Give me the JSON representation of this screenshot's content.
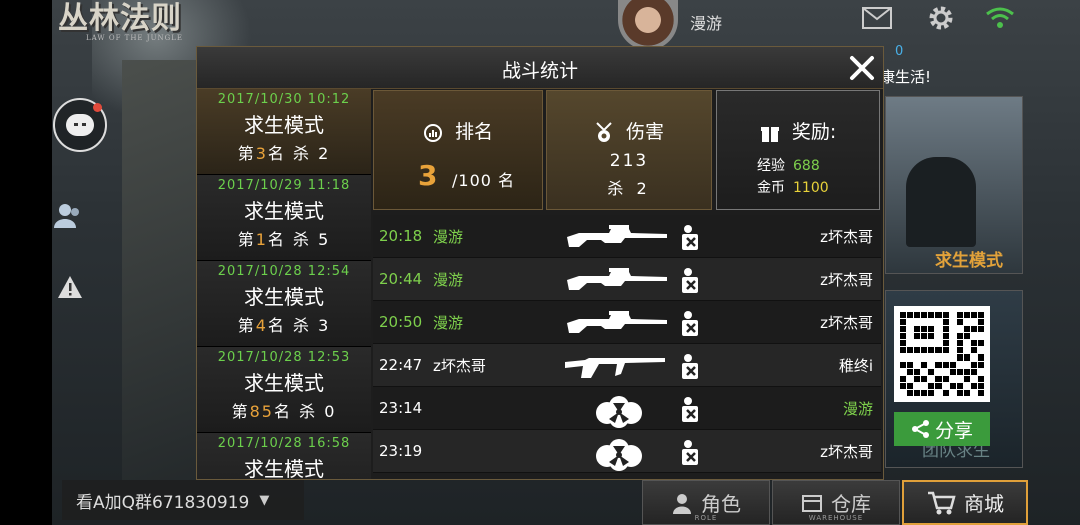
{
  "game": {
    "logo_main": "丛林法则",
    "logo_sub": "LAW OF THE JUNGLE"
  },
  "header": {
    "player_name": "漫游",
    "banner_text": "康生活!",
    "banner_prefix": "0"
  },
  "side": {
    "mode_card_label": "求生模式",
    "team_card_label": "团队求生",
    "share_label": "分享"
  },
  "chat_bar": {
    "text": "看A加Q群671830919",
    "caret": "▼"
  },
  "bottom_nav": [
    {
      "label": "角色",
      "sub": "ROLE"
    },
    {
      "label": "仓库",
      "sub": "WAREHOUSE"
    },
    {
      "label": "商城",
      "sub": ""
    }
  ],
  "modal": {
    "title": "战斗统计",
    "matches": [
      {
        "date": "2017/10/30 10:12",
        "mode": "求生模式",
        "rank_prefix": "第",
        "rank": "3",
        "rank_suffix": "名",
        "kill_label": "杀",
        "kills": "2"
      },
      {
        "date": "2017/10/29 11:18",
        "mode": "求生模式",
        "rank_prefix": "第",
        "rank": "1",
        "rank_suffix": "名",
        "kill_label": "杀",
        "kills": "5"
      },
      {
        "date": "2017/10/28 12:54",
        "mode": "求生模式",
        "rank_prefix": "第",
        "rank": "4",
        "rank_suffix": "名",
        "kill_label": "杀",
        "kills": "3"
      },
      {
        "date": "2017/10/28 12:53",
        "mode": "求生模式",
        "rank_prefix": "第",
        "rank": "85",
        "rank_suffix": "名",
        "kill_label": "杀",
        "kills": "0"
      },
      {
        "date": "2017/10/28 16:58",
        "mode": "求生模式",
        "rank_prefix": "",
        "rank": "",
        "rank_suffix": "",
        "kill_label": "",
        "kills": ""
      }
    ],
    "summary": {
      "rank_label": "排名",
      "rank_value": "3",
      "rank_total": "/100 名",
      "damage_label": "伤害",
      "damage_value": "213",
      "damage_kills": "杀 2",
      "reward_label": "奖励:",
      "exp_label": "经验",
      "exp_value": "688",
      "gold_label": "金币",
      "gold_value": "1100"
    },
    "log": [
      {
        "time": "20:18",
        "actor": "漫游",
        "weapon": "sniper-rifle",
        "victim": "z坏杰哥",
        "time_green": true,
        "victim_green": false
      },
      {
        "time": "20:44",
        "actor": "漫游",
        "weapon": "sniper-rifle",
        "victim": "z坏杰哥",
        "time_green": true,
        "victim_green": false
      },
      {
        "time": "20:50",
        "actor": "漫游",
        "weapon": "sniper-rifle",
        "victim": "z坏杰哥",
        "time_green": true,
        "victim_green": false
      },
      {
        "time": "22:47",
        "actor": "z坏杰哥",
        "weapon": "assault-rifle",
        "victim": "稚终i",
        "time_green": false,
        "victim_green": false
      },
      {
        "time": "23:14",
        "actor": "",
        "weapon": "poison-gas",
        "victim": "漫游",
        "time_green": false,
        "victim_green": true
      },
      {
        "time": "23:19",
        "actor": "",
        "weapon": "poison-gas",
        "victim": "z坏杰哥",
        "time_green": false,
        "victim_green": false
      }
    ]
  },
  "colors": {
    "accent_orange": "#e8a23a",
    "green": "#7ed04c",
    "share_green": "#3b9b3c"
  }
}
